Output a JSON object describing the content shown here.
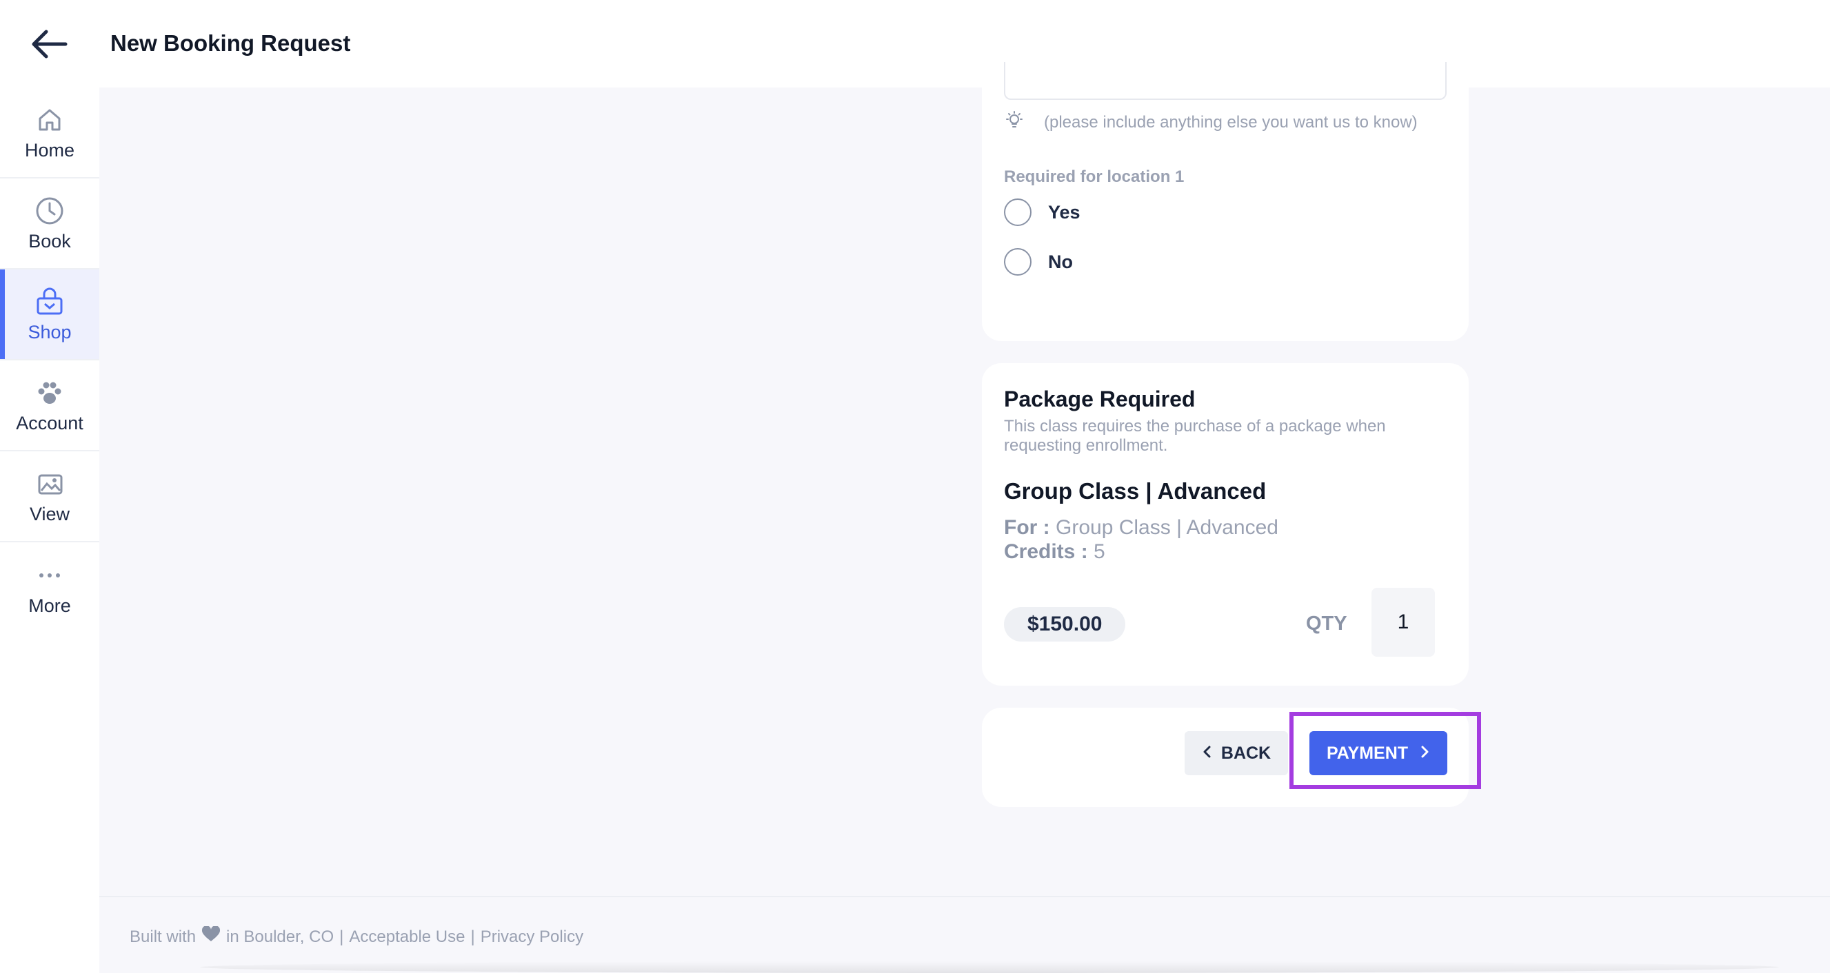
{
  "header": {
    "title": "New Booking Request"
  },
  "sidebar": {
    "items": [
      {
        "label": "Home",
        "icon": "home-icon"
      },
      {
        "label": "Book",
        "icon": "clock-icon"
      },
      {
        "label": "Shop",
        "icon": "shop-bag-icon",
        "active": true
      },
      {
        "label": "Account",
        "icon": "paw-icon"
      },
      {
        "label": "View",
        "icon": "gallery-icon"
      },
      {
        "label": "More",
        "icon": "more-dots-icon"
      }
    ]
  },
  "form": {
    "hint": "(please include anything else you want us to know)",
    "required_label": "Required for location 1",
    "options": [
      "Yes",
      "No"
    ]
  },
  "package": {
    "heading": "Package Required",
    "description": "This class requires the purchase of a package when requesting enrollment.",
    "name": "Group Class | Advanced",
    "for_label": "For :",
    "for_value": "Group Class | Advanced",
    "credits_label": "Credits :",
    "credits_value": "5",
    "price": "$150.00",
    "qty_label": "QTY",
    "qty_value": "1"
  },
  "actions": {
    "back_label": "BACK",
    "payment_label": "PAYMENT"
  },
  "footer": {
    "built_with": "Built with",
    "location": "in Boulder, CO",
    "acceptable_use": "Acceptable Use",
    "privacy_policy": "Privacy Policy",
    "separator": "|"
  },
  "colors": {
    "accent": "#4263eb",
    "highlight": "#a43ce0",
    "muted_text": "#9aa1b2"
  }
}
